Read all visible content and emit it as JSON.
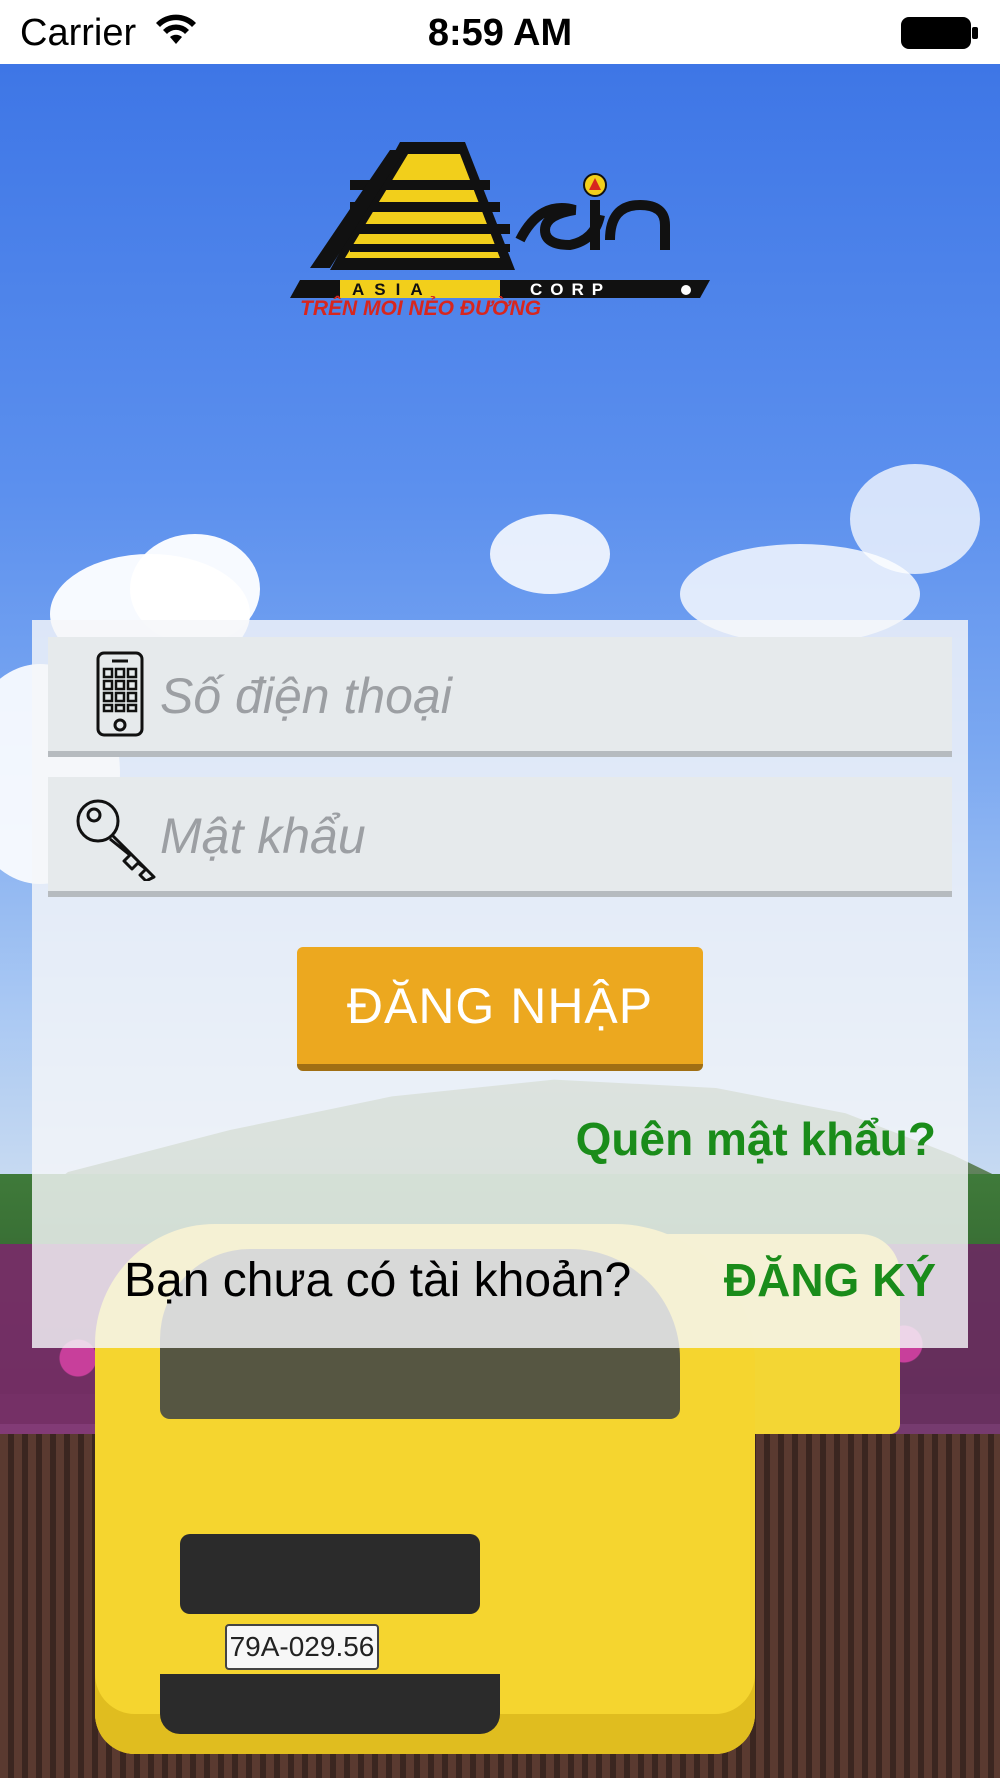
{
  "status_bar": {
    "carrier": "Carrier",
    "time": "8:59 AM"
  },
  "logo": {
    "brand_text": "ASIA CORP",
    "tagline": "TRÊN MỌI NẺO ĐƯỜNG",
    "colors": {
      "yellow": "#f2cf1b",
      "black": "#111111",
      "red": "#d7261e"
    }
  },
  "login": {
    "phone_placeholder": "Số điện thoại",
    "password_placeholder": "Mật khẩu",
    "login_button": "ĐĂNG NHẬP",
    "forgot_password": "Quên mật khẩu?",
    "no_account_prompt": "Bạn chưa có tài khoản?",
    "register_link": "ĐĂNG KÝ"
  },
  "background": {
    "plate_text": "79A-029.56"
  },
  "colors": {
    "button": "#eca81f",
    "link_green": "#1a8c1a",
    "field_bg": "#e6eaec"
  }
}
